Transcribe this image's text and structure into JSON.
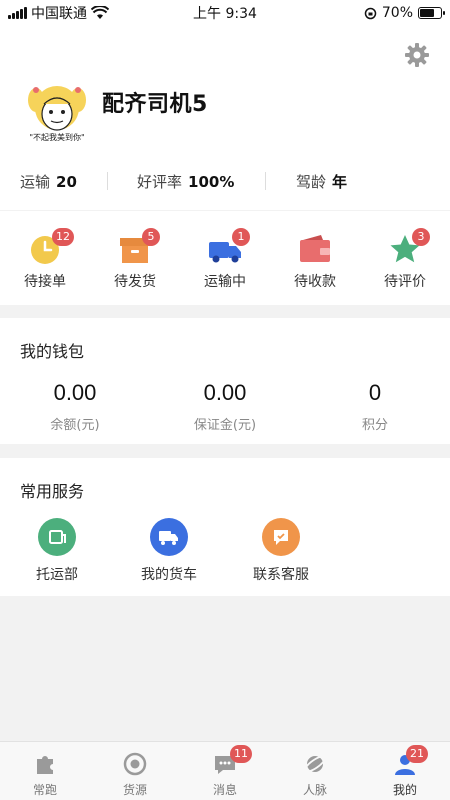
{
  "status_bar": {
    "carrier": "中国联通",
    "time": "上午 9:34",
    "battery": "70%",
    "battery_level": 0.7
  },
  "profile": {
    "username": "配齐司机5",
    "avatar_caption": "\"不起我美到你\"",
    "stats": [
      {
        "label": "运输",
        "value": "20"
      },
      {
        "label": "好评率",
        "value": "100%"
      },
      {
        "label": "驾龄",
        "value": "年"
      }
    ]
  },
  "orders": [
    {
      "label": "待接单",
      "badge": "12",
      "icon": "clock-icon",
      "color": "#f2c94c"
    },
    {
      "label": "待发货",
      "badge": "5",
      "icon": "box-icon",
      "color": "#f0954a"
    },
    {
      "label": "运输中",
      "badge": "1",
      "icon": "truck-icon",
      "color": "#3b6fe0"
    },
    {
      "label": "待收款",
      "badge": "",
      "icon": "wallet-icon",
      "color": "#e86d6d"
    },
    {
      "label": "待评价",
      "badge": "3",
      "icon": "star-icon",
      "color": "#4caf7d"
    }
  ],
  "wallet": {
    "title": "我的钱包",
    "items": [
      {
        "value": "0.00",
        "label": "余额(元)"
      },
      {
        "value": "0.00",
        "label": "保证金(元)"
      },
      {
        "value": "0",
        "label": "积分"
      }
    ]
  },
  "services": {
    "title": "常用服务",
    "items": [
      {
        "label": "托运部",
        "icon": "consign-icon",
        "color": "#4caf7d"
      },
      {
        "label": "我的货车",
        "icon": "truck-icon",
        "color": "#3b6fe0"
      },
      {
        "label": "联系客服",
        "icon": "chat-icon",
        "color": "#f0954a"
      }
    ]
  },
  "tabbar": [
    {
      "label": "常跑",
      "icon": "puzzle-icon",
      "badge": ""
    },
    {
      "label": "货源",
      "icon": "target-icon",
      "badge": ""
    },
    {
      "label": "消息",
      "icon": "message-icon",
      "badge": "11"
    },
    {
      "label": "人脉",
      "icon": "planet-icon",
      "badge": ""
    },
    {
      "label": "我的",
      "icon": "person-icon",
      "badge": "21",
      "active": true
    }
  ]
}
